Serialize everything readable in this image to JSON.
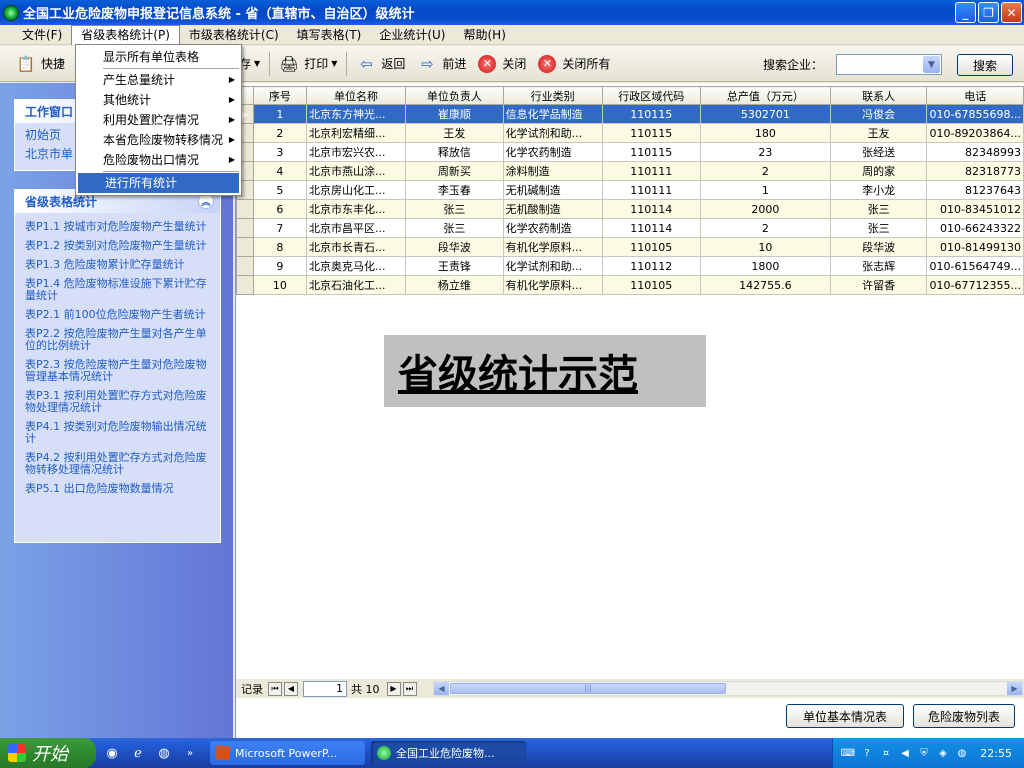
{
  "window": {
    "title": "全国工业危险废物申报登记信息系统 - 省（直辖市、自治区）级统计",
    "min_glyph": "_",
    "max_glyph": "❐",
    "close_glyph": "✕"
  },
  "menubar": [
    "文件(F)",
    "省级表格统计(P)",
    "市级表格统计(C)",
    "填写表格(T)",
    "企业统计(U)",
    "帮助(H)"
  ],
  "toolbar": {
    "quick": "快捷",
    "save": "保存",
    "print": "打印",
    "back": "返回",
    "forward": "前进",
    "close": "关闭",
    "close_all": "关闭所有",
    "search_label": "搜索企业：",
    "search_value": "",
    "search_button": "搜索"
  },
  "dropdown": {
    "items": [
      {
        "label": "显示所有单位表格",
        "submenu": false
      },
      {
        "label": "产生总量统计",
        "submenu": true
      },
      {
        "label": "其他统计",
        "submenu": true
      },
      {
        "label": "利用处置贮存情况",
        "submenu": true
      },
      {
        "label": "本省危险废物转移情况",
        "submenu": true
      },
      {
        "label": "危险废物出口情况",
        "submenu": true
      },
      {
        "label": "进行所有统计",
        "submenu": false
      }
    ]
  },
  "leftpane": {
    "work_window": {
      "title": "工作窗口",
      "items": [
        "初始页",
        "北京市单"
      ]
    },
    "provincial": {
      "title": "省级表格统计",
      "collapse_glyph": "︽",
      "items": [
        "表P1.1 按城市对危险废物产生量统计",
        "表P1.2 按类别对危险废物产生量统计",
        "表P1.3 危险废物累计贮存量统计",
        "表P1.4 危险废物标准设施下累计贮存量统计",
        "表P2.1 前100位危险废物产生者统计",
        "表P2.2 按危险废物产生量对各产生单位的比例统计",
        "表P2.3 按危险废物产生量对危险废物管理基本情况统计",
        "表P3.1 按利用处置贮存方式对危险废物处理情况统计",
        "表P4.1 按类别对危险废物输出情况统计",
        "表P4.2 按利用处置贮存方式对危险废物转移处理情况统计",
        "表P5.1 出口危险废物数量情况"
      ]
    }
  },
  "table": {
    "headers": [
      "序号",
      "单位名称",
      "单位负责人",
      "行业类别",
      "行政区域代码",
      "总产值（万元）",
      "联系人",
      "电话"
    ],
    "rows": [
      [
        "1",
        "北京东方神光...",
        "崔康顺",
        "信息化学品制造",
        "110115",
        "5302701",
        "冯俊会",
        "010-67855698..."
      ],
      [
        "2",
        "北京利宏精细...",
        "王发",
        "化学试剂和助...",
        "110115",
        "180",
        "王友",
        "010-89203864..."
      ],
      [
        "3",
        "北京市宏兴农...",
        "释放信",
        "化学农药制造",
        "110115",
        "23",
        "张经送",
        "82348993"
      ],
      [
        "4",
        "北京市燕山涂...",
        "周新买",
        "涂料制造",
        "110111",
        "2",
        "周的家",
        "82318773"
      ],
      [
        "5",
        "北京房山化工...",
        "李玉春",
        "无机碱制造",
        "110111",
        "1",
        "李小龙",
        "81237643"
      ],
      [
        "6",
        "北京市东丰化...",
        "张三",
        "无机酸制造",
        "110114",
        "2000",
        "张三",
        "010-83451012"
      ],
      [
        "7",
        "北京市昌平区...",
        "张三",
        "化学农药制造",
        "110114",
        "2",
        "张三",
        "010-66243322"
      ],
      [
        "8",
        "北京市长青石...",
        "段华波",
        "有机化学原料...",
        "110105",
        "10",
        "段华波",
        "010-81499130"
      ],
      [
        "9",
        "北京奥克马化...",
        "王责锋",
        "化学试剂和助...",
        "110112",
        "1800",
        "张志辉",
        "010-61564749..."
      ],
      [
        "10",
        "北京石油化工...",
        "杨立维",
        "有机化学原料...",
        "110105",
        "142755.6",
        "许留香",
        "010-67712355..."
      ]
    ],
    "selected_row": 1
  },
  "banner": "省级统计示范",
  "navigator": {
    "record_label": "记录",
    "page": "1",
    "total_label": "共 10"
  },
  "buttons": {
    "unit_info": "单位基本情况表",
    "waste_list": "危险废物列表"
  },
  "taskbar": {
    "start": "开始",
    "tasks": [
      "Microsoft PowerP...",
      "全国工业危险废物..."
    ],
    "clock": "22:55"
  },
  "colors": {
    "selection": "#316ac5",
    "titlebar": "#0348c8",
    "link": "#215dc6"
  }
}
